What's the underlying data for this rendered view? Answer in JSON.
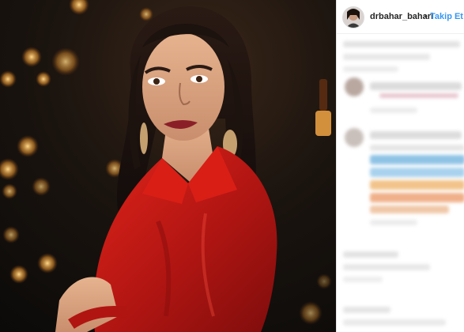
{
  "header": {
    "username": "drbahar_bahari",
    "separator": "•",
    "follow_label": "Takip Et"
  },
  "icons": {
    "avatar": "profile-photo",
    "main_photo": "portrait-photo"
  },
  "colors": {
    "link": "#3897f0",
    "text": "#262626",
    "dress": "#c4160f",
    "background": "#141110"
  }
}
